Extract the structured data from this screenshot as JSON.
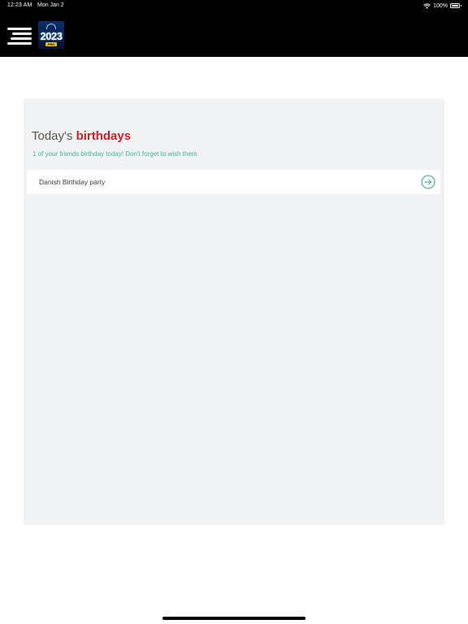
{
  "status_bar": {
    "time": "12:23 AM",
    "date": "Mon Jan 2",
    "battery": "100%",
    "wifi_icon": "wifi-icon",
    "battery_icon": "battery-icon"
  },
  "header": {
    "menu_icon": "hamburger-menu-icon",
    "logo": {
      "year": "2023",
      "badge": "PRO"
    },
    "background_color": "#000000"
  },
  "birthdays": {
    "title_prefix": "Today's ",
    "title_accent": "birthdays",
    "subtitle": "1 of your friends birthday today! Don't forget to wish them",
    "items": [
      {
        "name": "Danish Birthday party",
        "action_icon": "arrow-right-circle-icon"
      }
    ],
    "accent_color": "#d21e26",
    "subtitle_color": "#3fb69e"
  }
}
